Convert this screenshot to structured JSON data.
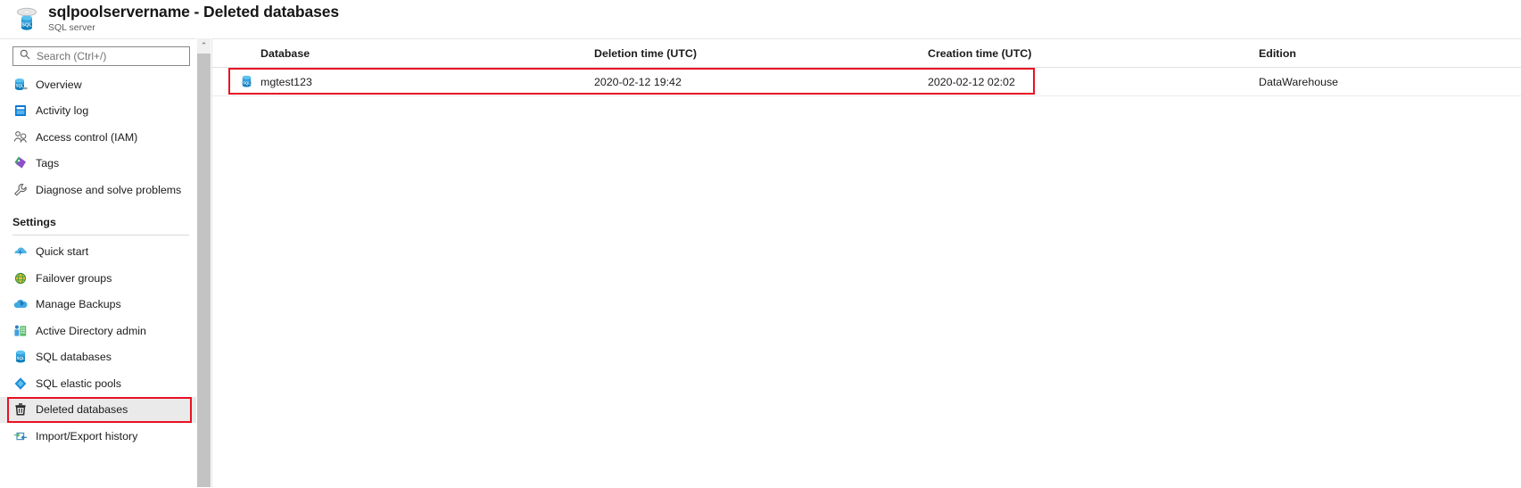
{
  "header": {
    "title": "sqlpoolservername - Deleted databases",
    "subtitle": "SQL server",
    "icon": "sql-server-icon"
  },
  "sidebar": {
    "search": {
      "placeholder": "Search (Ctrl+/)",
      "value": "",
      "icon": "search-icon"
    },
    "collapse_label": "«",
    "items": [
      {
        "label": "Overview",
        "icon": "sql-server-icon",
        "type": "item",
        "selected": false
      },
      {
        "label": "Activity log",
        "icon": "activity-log-icon",
        "type": "item",
        "selected": false
      },
      {
        "label": "Access control (IAM)",
        "icon": "access-control-icon",
        "type": "item",
        "selected": false
      },
      {
        "label": "Tags",
        "icon": "tags-icon",
        "type": "item",
        "selected": false
      },
      {
        "label": "Diagnose and solve problems",
        "icon": "wrench-icon",
        "type": "item",
        "selected": false
      },
      {
        "label": "Settings",
        "icon": "",
        "type": "section",
        "selected": false
      },
      {
        "label": "Quick start",
        "icon": "quick-start-icon",
        "type": "item",
        "selected": false
      },
      {
        "label": "Failover groups",
        "icon": "failover-groups-icon",
        "type": "item",
        "selected": false
      },
      {
        "label": "Manage Backups",
        "icon": "manage-backups-icon",
        "type": "item",
        "selected": false
      },
      {
        "label": "Active Directory admin",
        "icon": "active-directory-icon",
        "type": "item",
        "selected": false
      },
      {
        "label": "SQL databases",
        "icon": "sql-database-icon",
        "type": "item",
        "selected": false
      },
      {
        "label": "SQL elastic pools",
        "icon": "sql-elastic-pools-icon",
        "type": "item",
        "selected": false
      },
      {
        "label": "Deleted databases",
        "icon": "trash-icon",
        "type": "item",
        "selected": true
      },
      {
        "label": "Import/Export history",
        "icon": "import-export-icon",
        "type": "item",
        "selected": false
      }
    ],
    "scrollbar": {
      "up_arrow": "⌃"
    }
  },
  "table": {
    "columns": [
      {
        "key": "database",
        "label": "Database"
      },
      {
        "key": "deletion_time",
        "label": "Deletion time (UTC)"
      },
      {
        "key": "creation_time",
        "label": "Creation time (UTC)"
      },
      {
        "key": "edition",
        "label": "Edition"
      }
    ],
    "rows": [
      {
        "database": "mgtest123",
        "deletion_time": "2020-02-12 19:42",
        "creation_time": "2020-02-12 02:02",
        "edition": "DataWarehouse",
        "icon": "sql-database-icon"
      }
    ]
  },
  "annotations": {
    "highlight_color": "#e81123",
    "boxes": [
      {
        "target": "sidebar-item-deleted-databases"
      },
      {
        "target": "table-row-mgtest123"
      }
    ]
  }
}
